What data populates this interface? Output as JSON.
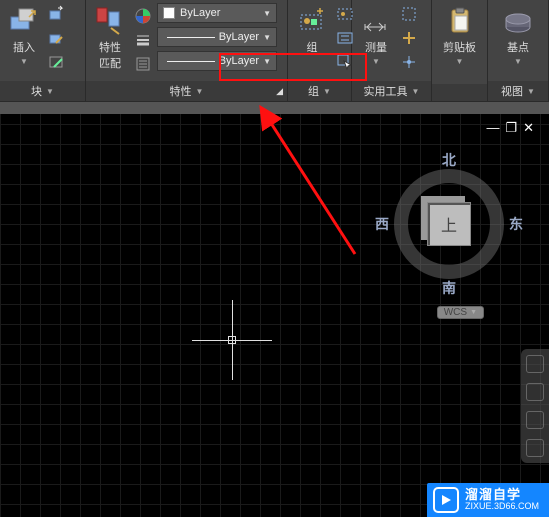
{
  "ribbon": {
    "insert": {
      "label": "插入",
      "panel": "块"
    },
    "match_props": {
      "label": "特性\n匹配"
    },
    "props": {
      "panel": "特性",
      "color": "ByLayer",
      "lineweight": "ByLayer",
      "linetype": "ByLayer"
    },
    "group": {
      "label": "组",
      "panel": "组"
    },
    "measure": {
      "label": "测量",
      "panel": "实用工具"
    },
    "clipboard": {
      "label": "剪贴板"
    },
    "base": {
      "label": "基点",
      "panel": "视图"
    }
  },
  "viewcube": {
    "top": "上",
    "n": "北",
    "s": "南",
    "e": "东",
    "w": "西"
  },
  "wcs": "WCS",
  "watermark": {
    "title": "溜溜自学",
    "url": "ZIXUE.3D66.COM"
  }
}
